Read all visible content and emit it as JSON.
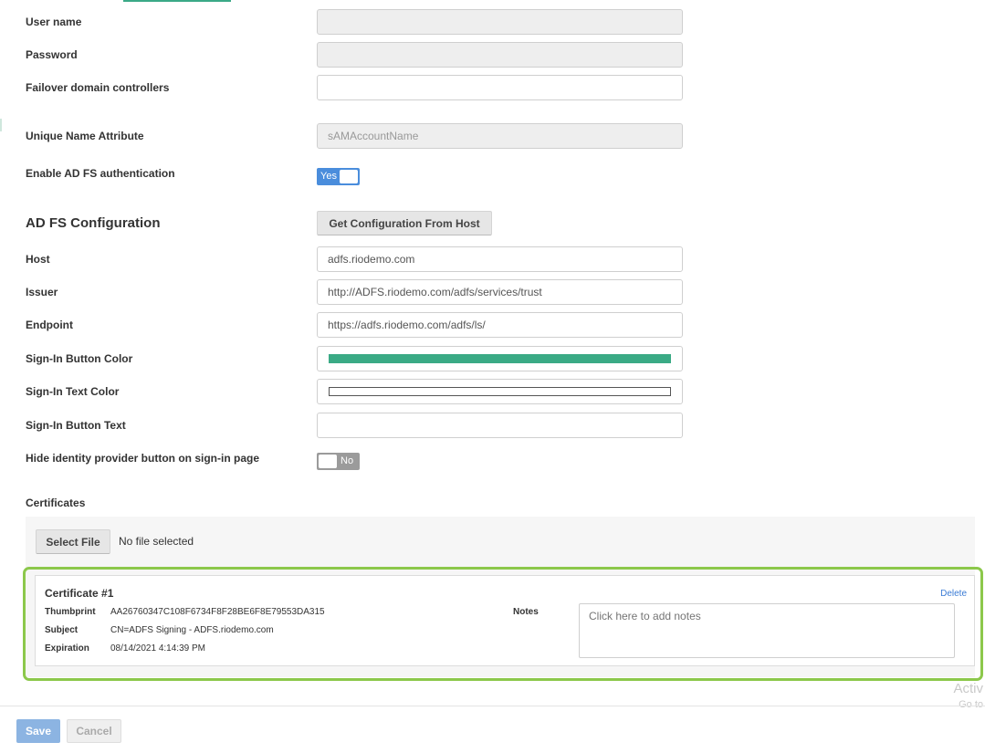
{
  "fields": {
    "username": {
      "label": "User name",
      "value": ""
    },
    "password": {
      "label": "Password",
      "value": ""
    },
    "failover": {
      "label": "Failover domain controllers",
      "value": ""
    },
    "unique_name": {
      "label": "Unique Name Attribute",
      "value": "sAMAccountName"
    },
    "enable_adfs": {
      "label": "Enable AD FS authentication",
      "toggle": "Yes"
    }
  },
  "adfs": {
    "title": "AD FS Configuration",
    "get_config_button": "Get Configuration From Host",
    "host": {
      "label": "Host",
      "value": "adfs.riodemo.com"
    },
    "issuer": {
      "label": "Issuer",
      "value": "http://ADFS.riodemo.com/adfs/services/trust"
    },
    "endpoint": {
      "label": "Endpoint",
      "value": "https://adfs.riodemo.com/adfs/ls/"
    },
    "button_color": {
      "label": "Sign-In Button Color",
      "color": "#3aaa85"
    },
    "text_color": {
      "label": "Sign-In Text Color",
      "color": "#ffffff"
    },
    "button_text": {
      "label": "Sign-In Button Text",
      "value": ""
    },
    "hide_button": {
      "label": "Hide identity provider button on sign-in page",
      "toggle": "No"
    }
  },
  "certificates": {
    "label": "Certificates",
    "select_file": "Select File",
    "no_file": "No file selected",
    "card": {
      "title": "Certificate #1",
      "delete": "Delete",
      "thumbprint_label": "Thumbprint",
      "thumbprint": "AA26760347C108F6734F8F28BE6F8E79553DA315",
      "subject_label": "Subject",
      "subject": "CN=ADFS Signing - ADFS.riodemo.com",
      "expiration_label": "Expiration",
      "expiration": "08/14/2021 4:14:39 PM",
      "notes_label": "Notes",
      "notes_placeholder": "Click here to add notes"
    }
  },
  "watermark": {
    "line1": "Activ",
    "line2": "Go to"
  },
  "footer": {
    "save": "Save",
    "cancel": "Cancel"
  }
}
